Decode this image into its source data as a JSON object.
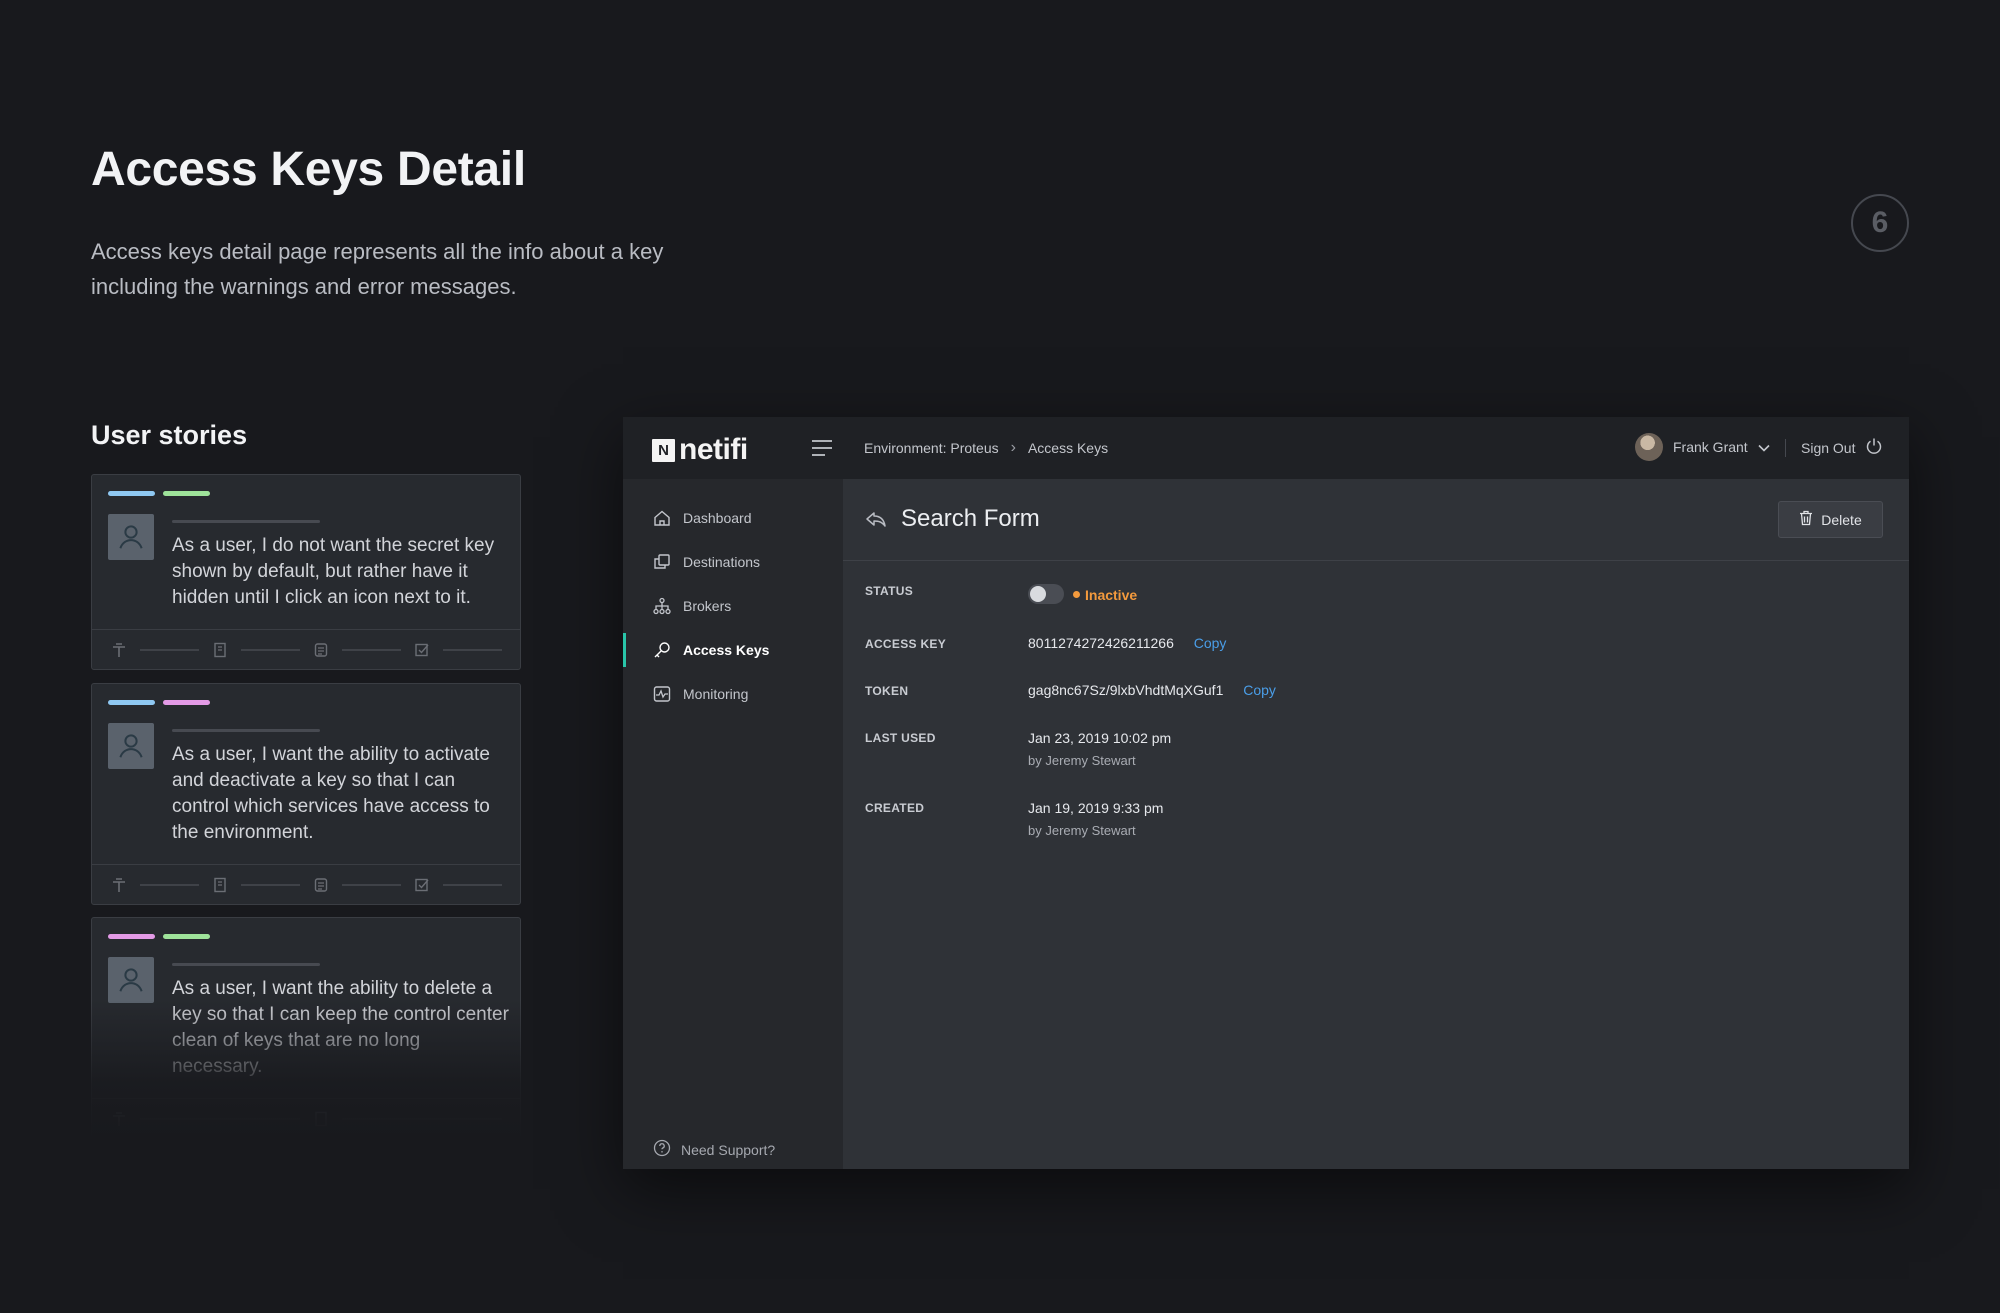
{
  "page": {
    "title": "Access Keys Detail",
    "description": "Access keys detail page represents all the info about a key including the warnings and error messages.",
    "number": "6"
  },
  "stories": {
    "heading": "User stories",
    "items": [
      {
        "text": "As a user, I do not want the secret key shown by default, but rather have it hidden until I click an icon next to it.",
        "tag_colors": [
          "#8fc8f2",
          "#9ee39a"
        ]
      },
      {
        "text": "As a user, I want the ability to activate and deactivate a key so that I can control which services have access to the environment.",
        "tag_colors": [
          "#8fc8f2",
          "#e39ae6"
        ]
      },
      {
        "text": "As a user, I want the ability to delete a key so that I can keep the control center clean of keys that are no long necessary.",
        "tag_colors": [
          "#e39ae6",
          "#9ee39a"
        ]
      }
    ]
  },
  "app": {
    "logo_letter": "N",
    "logo_text": "netifi",
    "breadcrumb": [
      "Environment: Proteus",
      "Access Keys"
    ],
    "user_name": "Frank Grant",
    "signout_label": "Sign Out",
    "nav": [
      {
        "label": "Dashboard",
        "icon": "home-icon"
      },
      {
        "label": "Destinations",
        "icon": "copy-icon"
      },
      {
        "label": "Brokers",
        "icon": "hierarchy-icon"
      },
      {
        "label": "Access Keys",
        "icon": "key-icon",
        "active": true
      },
      {
        "label": "Monitoring",
        "icon": "pulse-icon"
      }
    ],
    "support_label": "Need Support?",
    "content": {
      "title": "Search Form",
      "delete_label": "Delete",
      "status_label": "STATUS",
      "status_value": "Inactive",
      "access_key_label": "ACCESS KEY",
      "access_key_value": "8011274272426211266",
      "token_label": "TOKEN",
      "token_value": "gag8nc67Sz/9lxbVhdtMqXGuf1",
      "copy_label": "Copy",
      "last_used_label": "LAST USED",
      "last_used_value": "Jan 23, 2019 10:02 pm",
      "last_used_by": "by Jeremy Stewart",
      "created_label": "CREATED",
      "created_value": "Jan 19, 2019 9:33 pm",
      "created_by": "by Jeremy Stewart"
    },
    "colors": {
      "accent": "#29c5a9",
      "inactive": "#f39a3d",
      "link": "#4a9ee8"
    }
  }
}
